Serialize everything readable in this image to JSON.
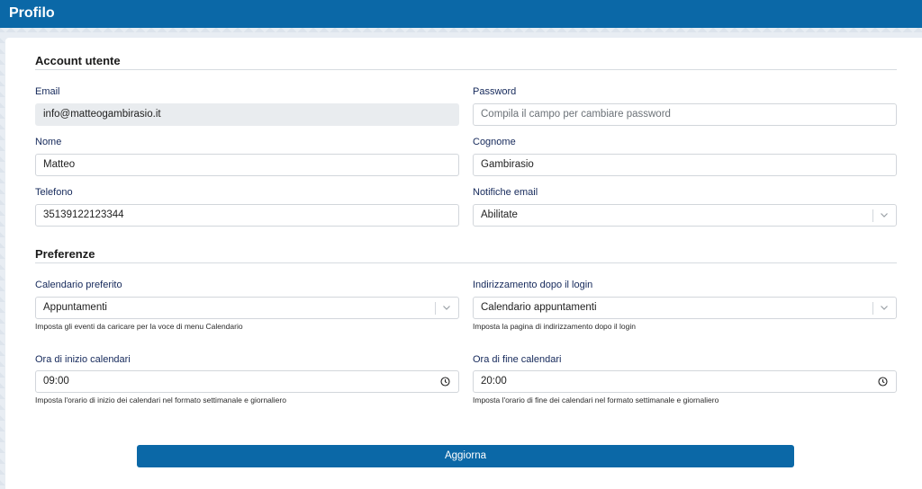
{
  "header": {
    "title": "Profilo"
  },
  "account_section": {
    "title": "Account utente",
    "email": {
      "label": "Email",
      "value": "info@matteogambirasio.it"
    },
    "password": {
      "label": "Password",
      "placeholder": "Compila il campo per cambiare password"
    },
    "nome": {
      "label": "Nome",
      "value": "Matteo"
    },
    "cognome": {
      "label": "Cognome",
      "value": "Gambirasio"
    },
    "telefono": {
      "label": "Telefono",
      "value": "35139122123344"
    },
    "notifiche": {
      "label": "Notifiche email",
      "value": "Abilitate"
    }
  },
  "preferences_section": {
    "title": "Preferenze",
    "calendario_preferito": {
      "label": "Calendario preferito",
      "value": "Appuntamenti",
      "help": "Imposta gli eventi da caricare per la voce di menu Calendario"
    },
    "redirect_login": {
      "label": "Indirizzamento dopo il login",
      "value": "Calendario appuntamenti",
      "help": "Imposta la pagina di indirizzamento dopo il login"
    },
    "ora_inizio": {
      "label": "Ora di inizio calendari",
      "value": "09:00",
      "help": "Imposta l'orario di inizio dei calendari nel formato settimanale e giornaliero"
    },
    "ora_fine": {
      "label": "Ora di fine calendari",
      "value": "20:00",
      "help": "Imposta l'orario di fine dei calendari nel formato settimanale e giornaliero"
    }
  },
  "actions": {
    "submit_label": "Aggiorna"
  },
  "icons": {
    "select": "chevron-down-icon",
    "time": "clock-icon"
  },
  "colors": {
    "primary": "#0b68a7",
    "label": "#14285a",
    "readonly_bg": "#e9ecef"
  }
}
